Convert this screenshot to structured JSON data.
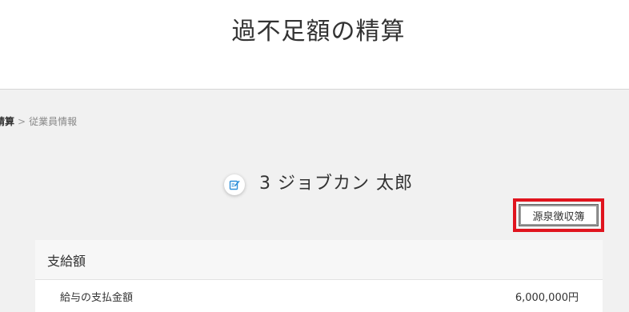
{
  "header": {
    "title": "過不足額の精算"
  },
  "breadcrumb": {
    "current": "精算",
    "separator": ">",
    "link": "従業員情報"
  },
  "employee": {
    "name": "3 ジョブカン 太郎"
  },
  "actions": {
    "withholding_ledger_label": "源泉徴収簿"
  },
  "colors": {
    "highlight": "#e0141e",
    "background": "#f1f1f1",
    "edit_icon": "#2f8fd8"
  },
  "icons": {
    "edit": "edit-pencil-icon"
  },
  "payment_section": {
    "title": "支給額",
    "rows": [
      {
        "label": "給与の支払金額",
        "value": "6,000,000円"
      }
    ]
  }
}
